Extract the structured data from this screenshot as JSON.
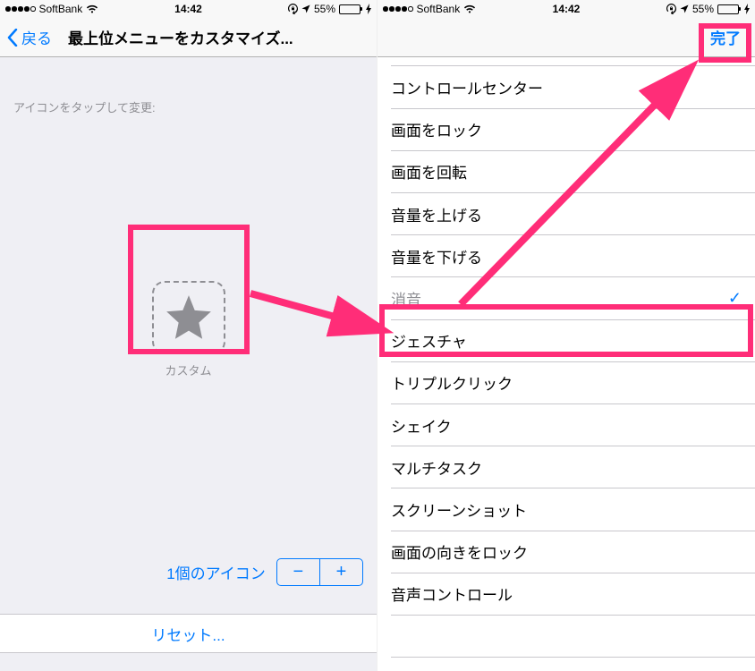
{
  "status_bar": {
    "carrier": "SoftBank",
    "time": "14:42",
    "battery_pct": "55%",
    "signal_dots": 4,
    "signal_total": 5
  },
  "left_screen": {
    "nav": {
      "back_label": "戻る",
      "title": "最上位メニューをカスタマイズ..."
    },
    "tap_hint": "アイコンをタップして変更:",
    "custom_label": "カスタム",
    "icon_count_label": "1個のアイコン",
    "stepper": {
      "minus": "−",
      "plus": "+"
    },
    "reset_label": "リセット..."
  },
  "right_screen": {
    "nav": {
      "done_label": "完了"
    },
    "list": [
      {
        "label": "コントロールセンター",
        "selected": false
      },
      {
        "label": "画面をロック",
        "selected": false
      },
      {
        "label": "画面を回転",
        "selected": false
      },
      {
        "label": "音量を上げる",
        "selected": false
      },
      {
        "label": "音量を下げる",
        "selected": false
      },
      {
        "label": "消音",
        "selected": true
      },
      {
        "label": "ジェスチャ",
        "selected": false
      },
      {
        "label": "トリプルクリック",
        "selected": false
      },
      {
        "label": "シェイク",
        "selected": false
      },
      {
        "label": "マルチタスク",
        "selected": false
      },
      {
        "label": "スクリーンショット",
        "selected": false
      },
      {
        "label": "画面の向きをロック",
        "selected": false
      },
      {
        "label": "音声コントロール",
        "selected": false
      },
      {
        "label": "",
        "selected": false
      }
    ]
  },
  "icons": {
    "star": "star-icon",
    "wifi": "wifi-icon",
    "location": "location-icon",
    "lock": "lock-icon",
    "bolt": "bolt-icon",
    "check": "✓"
  },
  "colors": {
    "accent": "#007aff",
    "highlight": "#ff2d78",
    "battery_fill": "#4cd964",
    "gray_text": "#8e8e93"
  }
}
